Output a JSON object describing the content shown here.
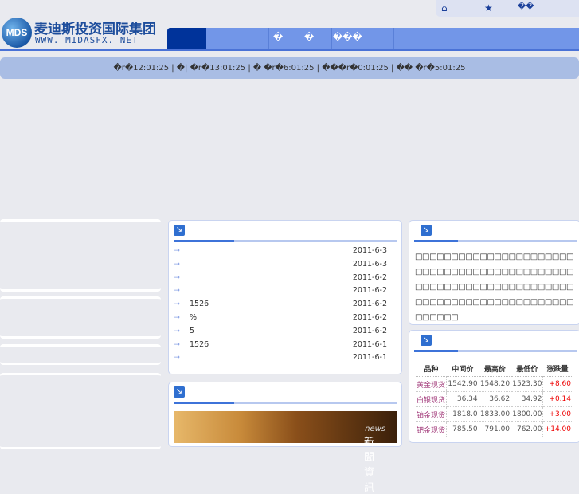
{
  "toplinks": {
    "home": "⌂",
    "favorite": "★",
    "contact": "��"
  },
  "logo": {
    "mark": "MDS",
    "name": "麦迪斯投资国际集团",
    "url": "WWW. MIDASFX. NET"
  },
  "nav": {
    "items": [
      "�",
      "�",
      "���"
    ]
  },
  "ticker": "�r�12:01:25 | �| �r�13:01:25 | � �r�6:01:25 | ���r�0:01:25 | �� �r�5:01:25",
  "news": [
    {
      "title": "",
      "date": "2011-6-3"
    },
    {
      "title": "",
      "date": "2011-6-3"
    },
    {
      "title": "",
      "date": "2011-6-2"
    },
    {
      "title": "",
      "date": "2011-6-2"
    },
    {
      "title": "   1526",
      "date": "2011-6-2"
    },
    {
      "title": "%",
      "date": "2011-6-2"
    },
    {
      "title": "   5",
      "date": "2011-6-2"
    },
    {
      "title": "     1526",
      "date": "2011-6-1"
    },
    {
      "title": "",
      "date": "2011-6-1"
    }
  ],
  "intro": "□□□□□□□□□□□□□□□□□□□□□□□□□□□□□□□□□□□□□□□□□□□□□□□□□□□□□□□□□□□□□□□□□□□□□□□□□□□□□□□□□□□□□□□□□□□□□□",
  "banner": {
    "title": "新聞資訊",
    "sub": "news"
  },
  "quotes": {
    "headers": [
      "品种",
      "中间价",
      "最高价",
      "最低价",
      "涨跌量"
    ],
    "rows": [
      [
        "黄金现货",
        "1542.90",
        "1548.20",
        "1523.30",
        "+8.60"
      ],
      [
        "白银现货",
        "36.34",
        "36.62",
        "34.92",
        "+0.14"
      ],
      [
        "铂金现货",
        "1818.0",
        "1833.00",
        "1800.00",
        "+3.00"
      ],
      [
        "钯金现货",
        "785.50",
        "791.00",
        "762.00",
        "+14.00"
      ]
    ]
  }
}
